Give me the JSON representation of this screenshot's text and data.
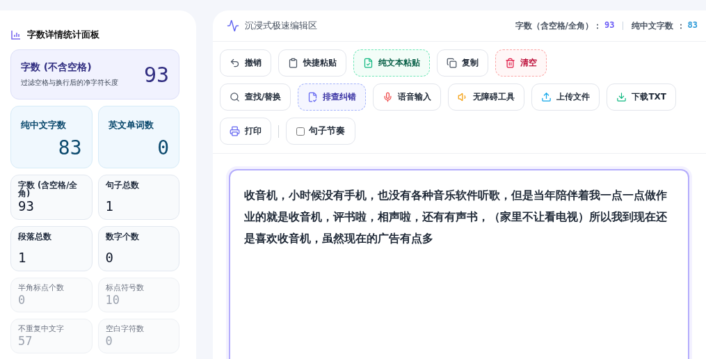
{
  "sidebar": {
    "title": "字数详情统计面板",
    "cards": [
      {
        "kind": "primary",
        "label": "字数 (不含空格)",
        "subtitle": "过滤空格与换行后的净字符长度",
        "value": "93"
      },
      {
        "kind": "highlight",
        "label": "纯中文字数",
        "value": "83"
      },
      {
        "kind": "highlight",
        "label": "英文单词数",
        "value": "0"
      },
      {
        "kind": "normal",
        "label": "字数 (含空格/全角)",
        "value": "93"
      },
      {
        "kind": "normal",
        "label": "句子总数",
        "value": "1"
      },
      {
        "kind": "normal",
        "label": "段落总数",
        "value": "1"
      },
      {
        "kind": "normal",
        "label": "数字个数",
        "value": "0"
      },
      {
        "kind": "muted",
        "label": "半角标点个数",
        "value": "0"
      },
      {
        "kind": "muted",
        "label": "标点符号数",
        "value": "10"
      },
      {
        "kind": "muted",
        "label": "不重复中文字",
        "value": "57"
      },
      {
        "kind": "muted",
        "label": "空白字符数",
        "value": "0"
      }
    ]
  },
  "editor": {
    "title": "沉浸式极速编辑区",
    "stats": [
      {
        "label": "字数（含空格/全角）：",
        "value": "93",
        "color": "#6b5cf6"
      },
      {
        "label": "纯中文字数 ：",
        "value": "83",
        "color": "#2b9ad8"
      }
    ],
    "toolbar_rows": [
      [
        {
          "kind": "button",
          "label": "撤销"
        },
        {
          "kind": "button",
          "label": "快捷粘贴"
        },
        {
          "kind": "button",
          "label": "纯文本粘贴"
        },
        {
          "kind": "button",
          "label": "复制"
        },
        {
          "kind": "button",
          "label": "清空"
        }
      ],
      [
        {
          "kind": "button",
          "label": "查找/替换"
        },
        {
          "kind": "button",
          "label": "排查纠错"
        },
        {
          "kind": "button",
          "label": "语音输入"
        },
        {
          "kind": "button",
          "label": "无障碍工具"
        },
        {
          "kind": "button",
          "label": "上传文件"
        },
        {
          "kind": "button",
          "label": "下载TXT"
        }
      ],
      [
        {
          "kind": "button",
          "label": "打印"
        },
        {
          "kind": "divider"
        },
        {
          "kind": "checkbox",
          "label": "句子节奏",
          "checked": false
        }
      ]
    ],
    "text": "收音机，小时候没有手机，也没有各种音乐软件听歌，但是当年陪伴着我一点一点做作业的就是收音机，评书啦，相声啦，还有有声书，（家里不让看电视）所以我到现在还是喜欢收音机，虽然现在的广告有点多"
  }
}
